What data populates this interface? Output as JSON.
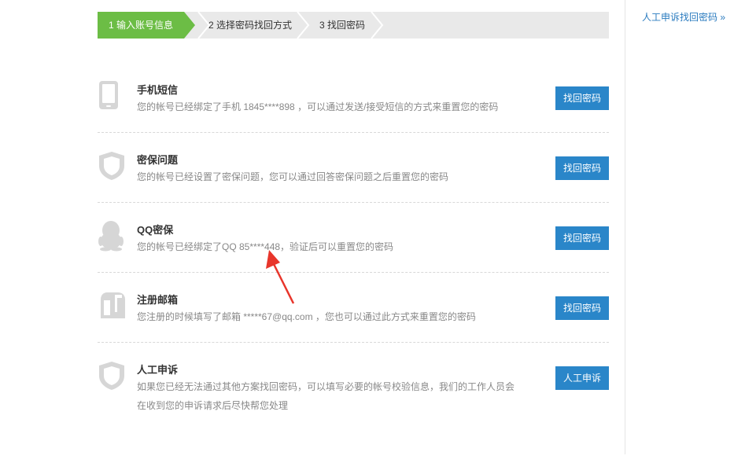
{
  "steps": [
    {
      "label": "1 输入账号信息",
      "active": true
    },
    {
      "label": "2 选择密码找回方式",
      "active": false
    },
    {
      "label": "3 找回密码",
      "active": false
    }
  ],
  "sidebar": {
    "link_label": "人工申诉找回密码 »"
  },
  "options": [
    {
      "icon": "phone-icon",
      "title": "手机短信",
      "desc": "您的帐号已经绑定了手机 1845****898 ，可以通过发送/接受短信的方式来重置您的密码",
      "button": "找回密码"
    },
    {
      "icon": "shield-icon",
      "title": "密保问题",
      "desc": "您的帐号已经设置了密保问题，您可以通过回答密保问题之后重置您的密码",
      "button": "找回密码"
    },
    {
      "icon": "penguin-icon",
      "title": "QQ密保",
      "desc": "您的帐号已经绑定了QQ 85****448，验证后可以重置您的密码",
      "button": "找回密码"
    },
    {
      "icon": "mailbox-icon",
      "title": "注册邮箱",
      "desc": "您注册的时候填写了邮箱 *****67@qq.com ，您也可以通过此方式来重置您的密码",
      "button": "找回密码"
    },
    {
      "icon": "shield-icon",
      "title": "人工申诉",
      "desc_lines": [
        "如果您已经无法通过其他方案找回密码，可以填写必要的帐号校验信息，我们的工作人员会",
        "在收到您的申诉请求后尽快帮您处理"
      ],
      "button": "人工申诉"
    }
  ],
  "colors": {
    "step_active": "#6cbd45",
    "button": "#2a86c9",
    "link": "#2a7bbf",
    "arrow": "#e8352b"
  }
}
